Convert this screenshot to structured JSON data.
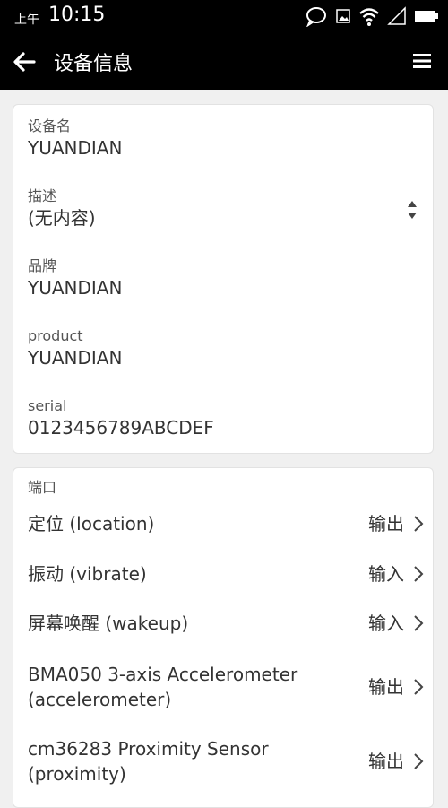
{
  "status_bar": {
    "ampm": "上午",
    "time": "10:15"
  },
  "toolbar": {
    "title": "设备信息"
  },
  "device": [
    {
      "label": "设备名",
      "value": "YUANDIAN"
    },
    {
      "label": "描述",
      "value": "(无内容)"
    },
    {
      "label": "品牌",
      "value": "YUANDIAN"
    },
    {
      "label": "product",
      "value": "YUANDIAN"
    },
    {
      "label": "serial",
      "value": "0123456789ABCDEF"
    }
  ],
  "ports": {
    "header": "端口",
    "items": [
      {
        "name": "定位 (location)",
        "direction": "输出"
      },
      {
        "name": "振动 (vibrate)",
        "direction": "输入"
      },
      {
        "name": "屏幕唤醒 (wakeup)",
        "direction": "输入"
      },
      {
        "name": "BMA050 3-axis Accelerometer (accelerometer)",
        "direction": "输出"
      },
      {
        "name": "cm36283 Proximity Sensor (proximity)",
        "direction": "输出"
      }
    ]
  }
}
